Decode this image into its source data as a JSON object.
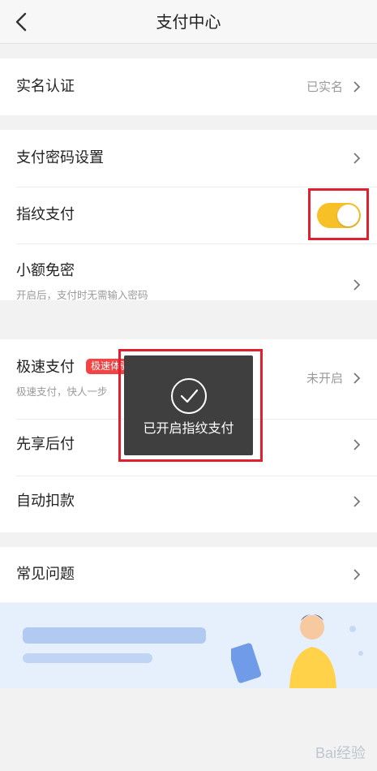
{
  "header": {
    "title": "支付中心"
  },
  "groups": {
    "realname": {
      "label": "实名认证",
      "value": "已实名"
    },
    "password": {
      "label": "支付密码设置"
    },
    "fingerprint": {
      "label": "指纹支付",
      "enabled": true
    },
    "small_free": {
      "label": "小额免密",
      "sub": "开启后，支付时无需输入密码"
    },
    "fast_pay": {
      "label": "极速支付",
      "badge": "极速体验",
      "sub": "极速支付，快人一步",
      "value": "未开启"
    },
    "enjoy_first": {
      "label": "先享后付"
    },
    "auto_deduct": {
      "label": "自动扣款"
    },
    "faq": {
      "label": "常见问题"
    }
  },
  "toast": {
    "message": "已开启指纹支付"
  },
  "watermark": "Bai经验",
  "colors": {
    "toggle_on": "#f8c027",
    "badge": "#f24444",
    "highlight": "#e0202e"
  }
}
